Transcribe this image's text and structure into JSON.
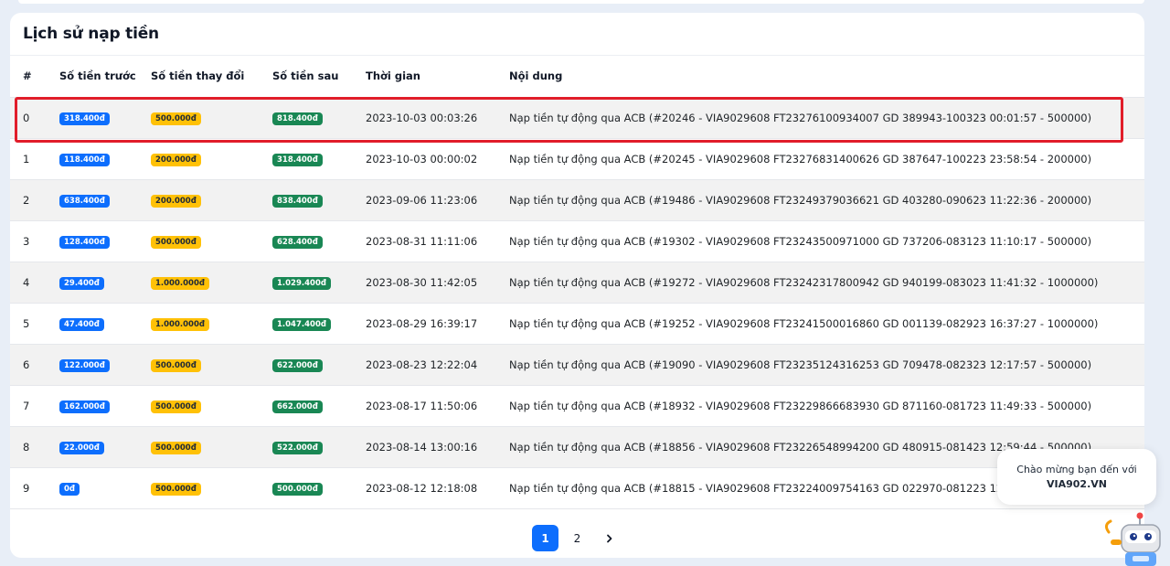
{
  "card": {
    "title": "Lịch sử nạp tiền"
  },
  "table": {
    "headers": [
      "#",
      "Số tiền trước",
      "Số tiền thay đổi",
      "Số tiền sau",
      "Thời gian",
      "Nội dung"
    ],
    "rows": [
      {
        "index": "0",
        "before": "318.400đ",
        "change": "500.000đ",
        "after": "818.400đ",
        "time": "2023-10-03 00:03:26",
        "content": "Nạp tiền tự động qua ACB (#20246 - VIA9029608 FT23276100934007 GD 389943-100323 00:01:57 - 500000)"
      },
      {
        "index": "1",
        "before": "118.400đ",
        "change": "200.000đ",
        "after": "318.400đ",
        "time": "2023-10-03 00:00:02",
        "content": "Nạp tiền tự động qua ACB (#20245 - VIA9029608 FT23276831400626 GD 387647-100223 23:58:54 - 200000)"
      },
      {
        "index": "2",
        "before": "638.400đ",
        "change": "200.000đ",
        "after": "838.400đ",
        "time": "2023-09-06 11:23:06",
        "content": "Nạp tiền tự động qua ACB (#19486 - VIA9029608 FT23249379036621 GD 403280-090623 11:22:36 - 200000)"
      },
      {
        "index": "3",
        "before": "128.400đ",
        "change": "500.000đ",
        "after": "628.400đ",
        "time": "2023-08-31 11:11:06",
        "content": "Nạp tiền tự động qua ACB (#19302 - VIA9029608 FT23243500971000 GD 737206-083123 11:10:17 - 500000)"
      },
      {
        "index": "4",
        "before": "29.400đ",
        "change": "1.000.000đ",
        "after": "1.029.400đ",
        "time": "2023-08-30 11:42:05",
        "content": "Nạp tiền tự động qua ACB (#19272 - VIA9029608 FT23242317800942 GD 940199-083023 11:41:32 - 1000000)"
      },
      {
        "index": "5",
        "before": "47.400đ",
        "change": "1.000.000đ",
        "after": "1.047.400đ",
        "time": "2023-08-29 16:39:17",
        "content": "Nạp tiền tự động qua ACB (#19252 - VIA9029608 FT23241500016860 GD 001139-082923 16:37:27 - 1000000)"
      },
      {
        "index": "6",
        "before": "122.000đ",
        "change": "500.000đ",
        "after": "622.000đ",
        "time": "2023-08-23 12:22:04",
        "content": "Nạp tiền tự động qua ACB (#19090 - VIA9029608 FT23235124316253 GD 709478-082323 12:17:57 - 500000)"
      },
      {
        "index": "7",
        "before": "162.000đ",
        "change": "500.000đ",
        "after": "662.000đ",
        "time": "2023-08-17 11:50:06",
        "content": "Nạp tiền tự động qua ACB (#18932 - VIA9029608 FT23229866683930 GD 871160-081723 11:49:33 - 500000)"
      },
      {
        "index": "8",
        "before": "22.000đ",
        "change": "500.000đ",
        "after": "522.000đ",
        "time": "2023-08-14 13:00:16",
        "content": "Nạp tiền tự động qua ACB (#18856 - VIA9029608 FT23226548994200 GD 480915-081423 12:59:44 - 500000)"
      },
      {
        "index": "9",
        "before": "0đ",
        "change": "500.000đ",
        "after": "500.000đ",
        "time": "2023-08-12 12:18:08",
        "content": "Nạp tiền tự động qua ACB (#18815 - VIA9029608 FT23224009754163 GD 022970-081223 12:17:18 - 500000)"
      }
    ]
  },
  "pagination": {
    "pages": [
      "1",
      "2"
    ],
    "active": "1",
    "next_icon": "chevron-right-icon"
  },
  "chat": {
    "line1": "Chào mừng bạn đến với",
    "line2": "VIA902.VN",
    "avatar_icon": "robot-icon"
  },
  "colors": {
    "before_badge": "#0d6efd",
    "change_badge": "#ffc107",
    "after_badge": "#198754",
    "highlight_border": "#e11d2a",
    "active_page": "#0d6efd"
  }
}
